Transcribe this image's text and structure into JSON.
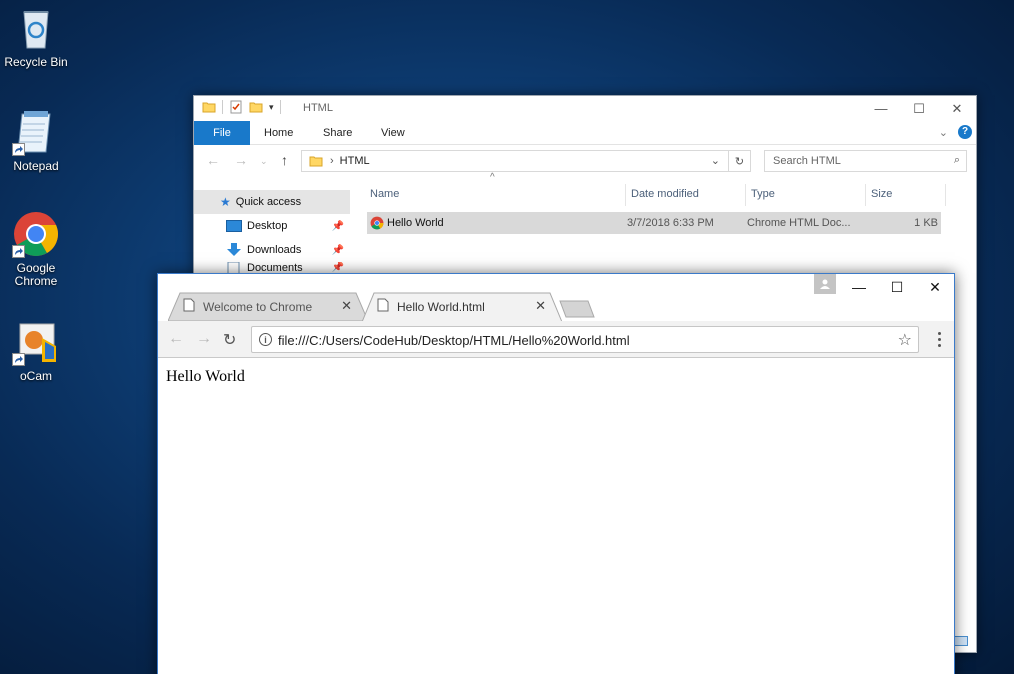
{
  "desktop": {
    "icons": [
      {
        "label": "Recycle Bin"
      },
      {
        "label": "Notepad"
      },
      {
        "label": "Google Chrome"
      },
      {
        "label": "oCam"
      }
    ]
  },
  "explorer": {
    "title": "HTML",
    "ribbon_tabs": [
      "File",
      "Home",
      "Share",
      "View"
    ],
    "address": "HTML",
    "search_placeholder": "Search HTML",
    "nav": {
      "quick_access": "Quick access",
      "items": [
        "Desktop",
        "Downloads",
        "Documents"
      ]
    },
    "columns": [
      "Name",
      "Date modified",
      "Type",
      "Size"
    ],
    "files": [
      {
        "name": "Hello World",
        "date": "3/7/2018 6:33 PM",
        "type": "Chrome HTML Doc...",
        "size": "1 KB"
      }
    ]
  },
  "chrome": {
    "tabs": [
      {
        "title": "Welcome to Chrome",
        "active": false
      },
      {
        "title": "Hello World.html",
        "active": true
      }
    ],
    "url": "file:///C:/Users/CodeHub/Desktop/HTML/Hello%20World.html",
    "page_text": "Hello World"
  },
  "colors": {
    "accent": "#1979ca",
    "chrome_border": "#3b7ac9"
  }
}
